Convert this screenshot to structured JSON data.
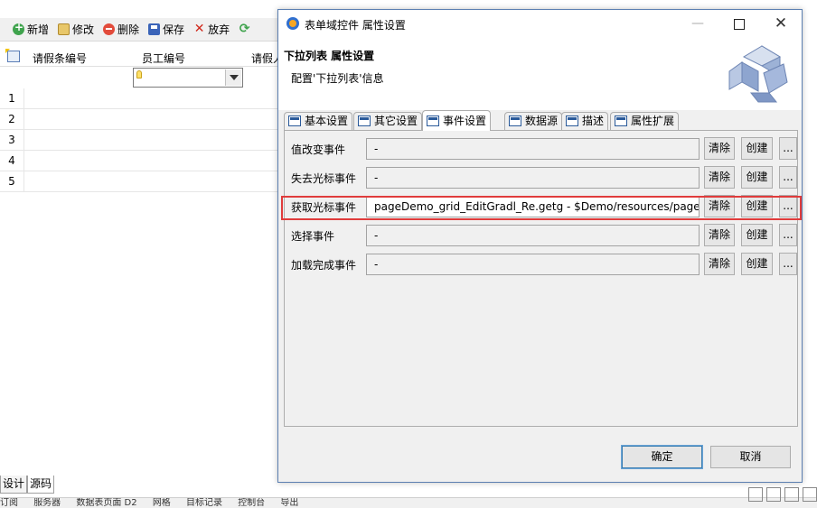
{
  "toolbar": {
    "items": [
      {
        "label": "新增",
        "icon": "add-icon"
      },
      {
        "label": "修改",
        "icon": "edit-icon"
      },
      {
        "label": "删除",
        "icon": "delete-icon"
      },
      {
        "label": "保存",
        "icon": "save-icon"
      },
      {
        "label": "放弃",
        "icon": "discard-icon"
      }
    ]
  },
  "grid": {
    "columns": [
      "请假条编号",
      "员工编号",
      "请假人"
    ],
    "rows": [
      "1",
      "2",
      "3",
      "4",
      "5"
    ]
  },
  "bottom_tabs": [
    "设计",
    "源码"
  ],
  "status_strip": [
    "订阅",
    "服务器",
    "数据表页面 D2",
    "网格",
    "目标记录",
    "控制台",
    "导出"
  ],
  "dialog": {
    "title": "表单域控件 属性设置",
    "header_title": "下拉列表 属性设置",
    "header_subtitle": "配置'下拉列表'信息",
    "tabs": [
      "基本设置",
      "其它设置",
      "事件设置",
      "数据源",
      "描述",
      "属性扩展"
    ],
    "active_tab": "事件设置",
    "events": [
      {
        "label": "值改变事件",
        "value": "-"
      },
      {
        "label": "失去光标事件",
        "value": "-"
      },
      {
        "label": "获取光标事件",
        "value": "pageDemo_grid_EditGradl_Re.getg - $Demo/resources/pageD"
      },
      {
        "label": "选择事件",
        "value": "-"
      },
      {
        "label": "加载完成事件",
        "value": "-"
      }
    ],
    "clear_label": "清除",
    "create_label": "创建",
    "more_label": "...",
    "ok_label": "确定",
    "cancel_label": "取消",
    "highlight_color": "#e03c3c"
  }
}
